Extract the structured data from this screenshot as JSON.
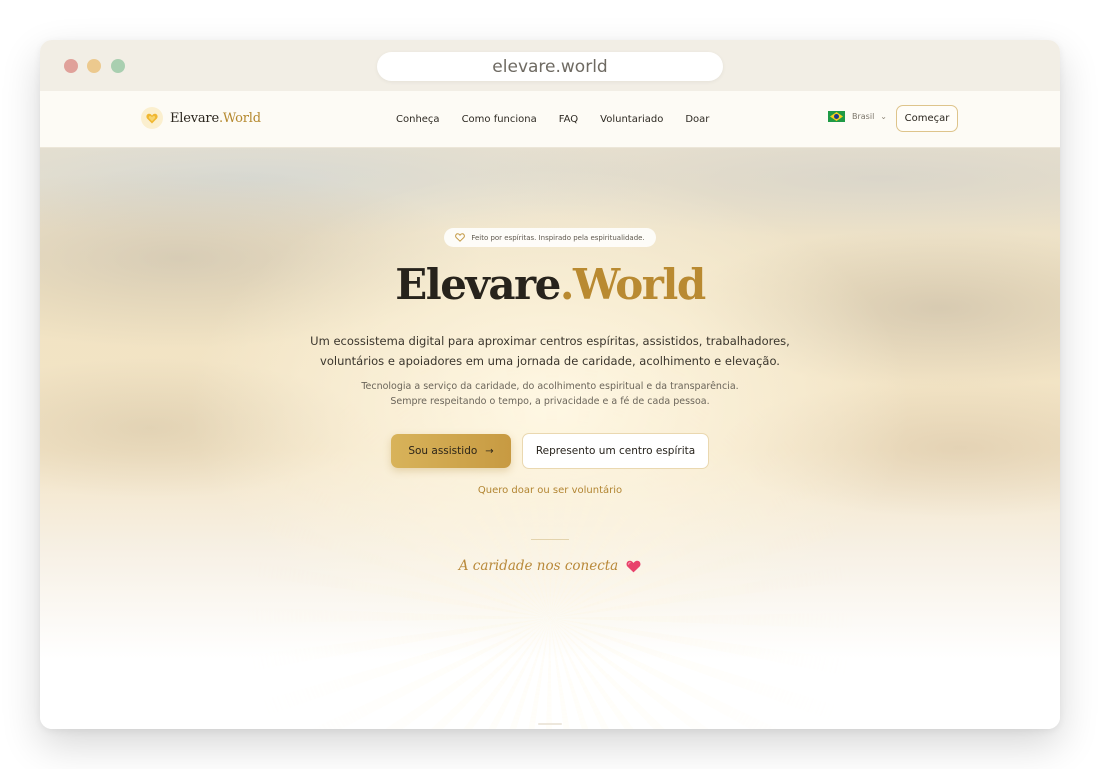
{
  "browser": {
    "url": "elevare.world"
  },
  "nav": {
    "logo": {
      "name": "Elevare",
      "accent": ".World"
    },
    "menu": [
      "Conheça",
      "Como funciona",
      "FAQ",
      "Voluntariado",
      "Doar"
    ],
    "language": "Brasil",
    "cta": "Começar"
  },
  "hero": {
    "badge": "Feito por espíritas. Inspirado pela espiritualidade.",
    "title": {
      "main": "Elevare",
      "accent": ".World"
    },
    "subtitle_line1": "Um ecossistema digital para aproximar centros espíritas, assistidos, trabalhadores,",
    "subtitle_line2": "voluntários e apoiadores em uma jornada de caridade, acolhimento e elevação.",
    "tagline_line1": "Tecnologia a serviço da caridade, do acolhimento espiritual e da transparência.",
    "tagline_line2": "Sempre respeitando o tempo, a privacidade e a fé de cada pessoa.",
    "primary_button": "Sou assistido",
    "secondary_button": "Represento um centro espírita",
    "donate_link": "Quero doar ou ser voluntário",
    "motto": "A caridade nos conecta"
  },
  "colors": {
    "gold": "#b98a31",
    "ink": "#27231c",
    "heart": "#e8426b"
  }
}
